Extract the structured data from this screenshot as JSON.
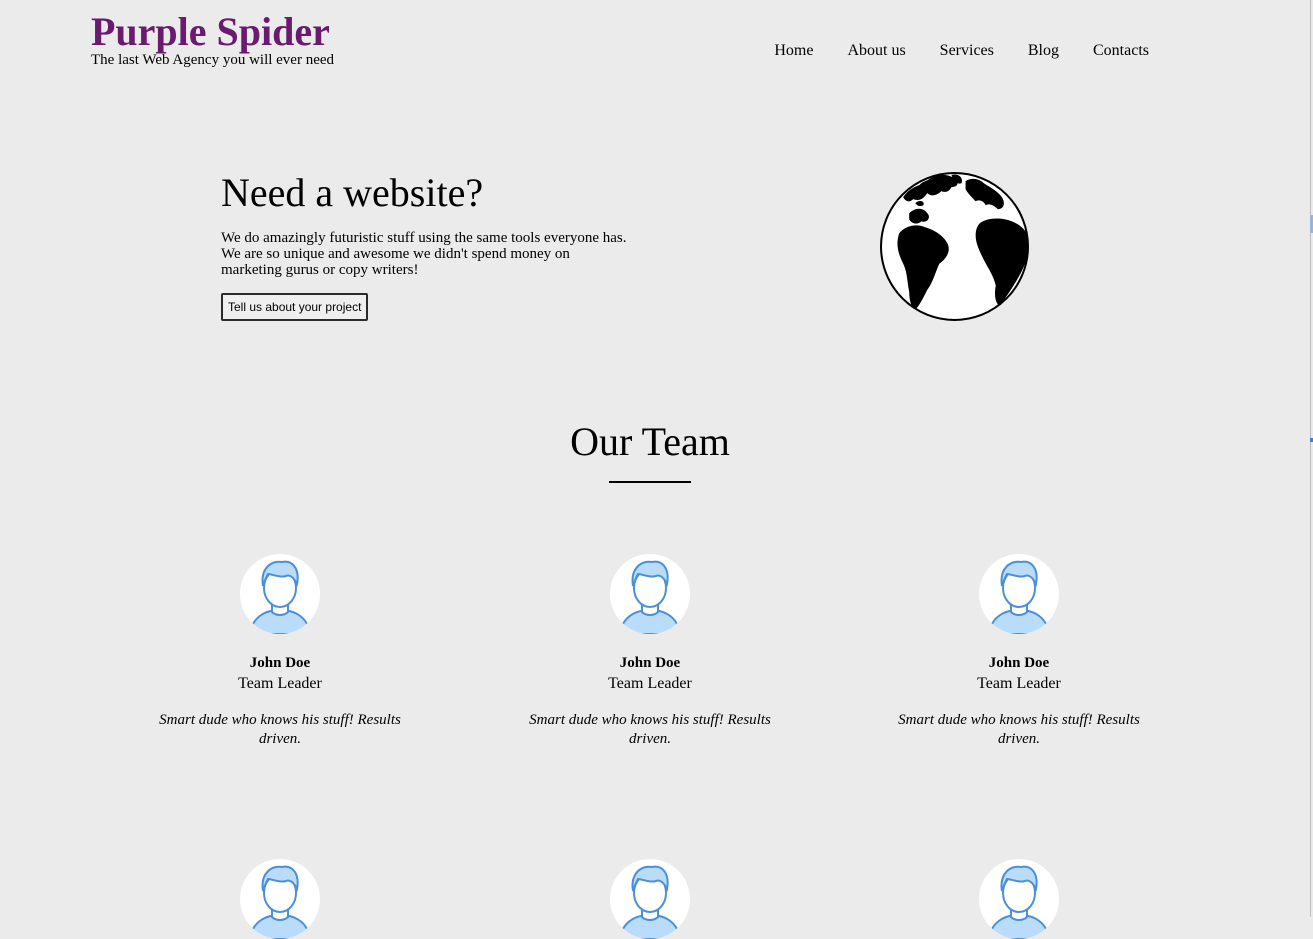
{
  "header": {
    "brand_title": "Purple Spider",
    "brand_tagline": "The last Web Agency you will ever need",
    "brand_color": "#6a1b6e",
    "nav": [
      {
        "label": "Home"
      },
      {
        "label": "About us"
      },
      {
        "label": "Services"
      },
      {
        "label": "Blog"
      },
      {
        "label": "Contacts"
      }
    ]
  },
  "hero": {
    "heading": "Need a website?",
    "text": "We do amazingly futuristic stuff using the same tools everyone has. We are so unique and awesome we didn't spend money on marketing gurus or copy writers!",
    "button_label": "Tell us about your project",
    "image_icon": "globe-icon"
  },
  "team": {
    "title": "Our Team",
    "members": [
      {
        "name": "John Doe",
        "role": "Team Leader",
        "bio": "Smart dude who knows his stuff! Results driven."
      },
      {
        "name": "John Doe",
        "role": "Team Leader",
        "bio": "Smart dude who knows his stuff! Results driven."
      },
      {
        "name": "John Doe",
        "role": "Team Leader",
        "bio": "Smart dude who knows his stuff! Results driven."
      },
      {
        "name": "",
        "role": "",
        "bio": ""
      },
      {
        "name": "",
        "role": "",
        "bio": ""
      },
      {
        "name": "",
        "role": "",
        "bio": ""
      }
    ],
    "avatar_icon": "user-avatar-icon",
    "avatar_color": "#b9dcfa",
    "avatar_stroke": "#4a90d9"
  },
  "colors": {
    "background": "#ebebeb",
    "text": "#000000"
  }
}
